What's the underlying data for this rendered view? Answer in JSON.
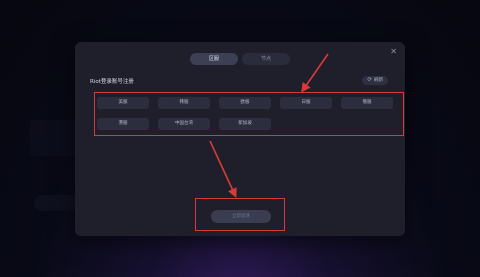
{
  "dialog": {
    "tabs": [
      {
        "label": "区服",
        "active": true
      },
      {
        "label": "节点",
        "active": false
      }
    ],
    "section_title": "Riot登录账号注册",
    "refresh_label": "刷新",
    "servers_row1": [
      "美服",
      "韩服",
      "欧服",
      "日服",
      "俄服"
    ],
    "servers_row2": [
      "港服",
      "中国台湾",
      "新加坡"
    ],
    "primary_button": "立即加速",
    "close_icon": "✕"
  },
  "colors": {
    "annotation_red": "#d83a3a",
    "dialog_bg": "#1e1f2b",
    "accent_purple": "#4b2a8a"
  }
}
